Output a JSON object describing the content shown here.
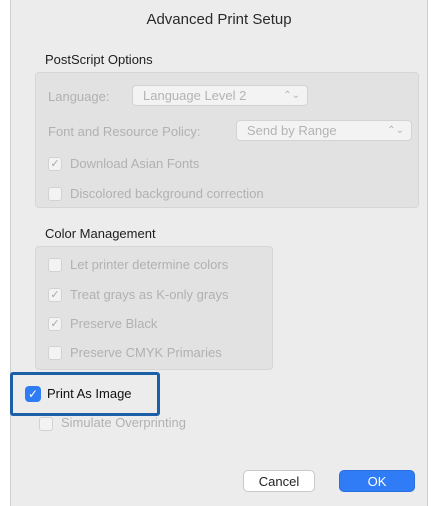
{
  "title": "Advanced Print Setup",
  "postscript": {
    "heading": "PostScript Options",
    "language_label": "Language:",
    "language_value": "Language Level 2",
    "font_policy_label": "Font and Resource Policy:",
    "font_policy_value": "Send by Range",
    "download_asian_fonts": "Download Asian Fonts",
    "discolored_bg": "Discolored background correction"
  },
  "color_management": {
    "heading": "Color Management",
    "let_printer": "Let printer determine colors",
    "treat_grays": "Treat grays as K-only grays",
    "preserve_black": "Preserve Black",
    "preserve_cmyk": "Preserve CMYK Primaries"
  },
  "print_as_image": "Print As Image",
  "simulate_overprinting": "Simulate Overprinting",
  "buttons": {
    "cancel": "Cancel",
    "ok": "OK"
  },
  "check_glyph": "✓",
  "updown_glyph": "⌃⌄",
  "icons": {
    "checkmark": "checkmark-icon",
    "popup_arrows": "updown-chevron-icon"
  },
  "colors": {
    "accent": "#2f7cf6",
    "highlight_border": "#1b5fa6"
  }
}
